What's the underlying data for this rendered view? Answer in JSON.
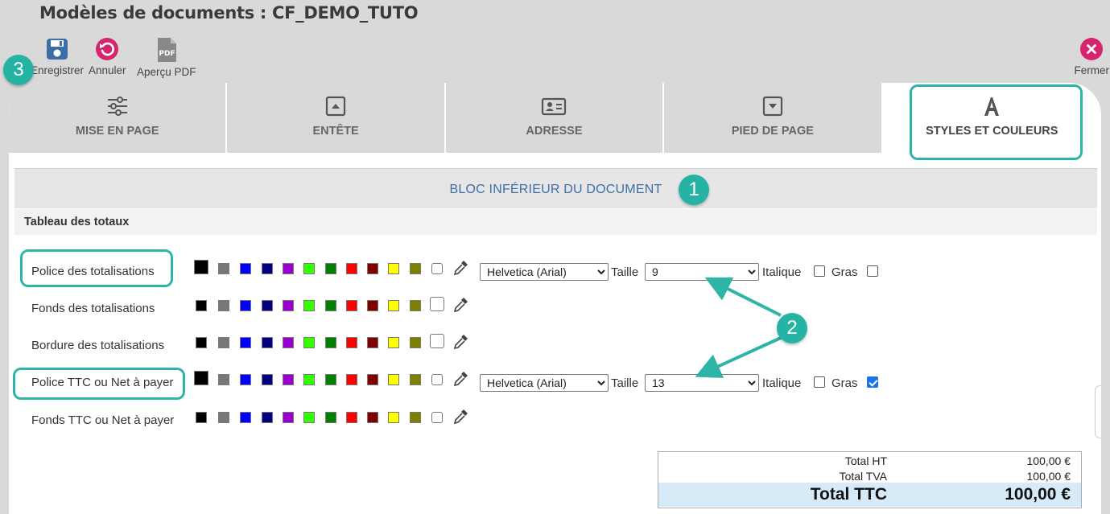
{
  "page": {
    "title": "Modèles de documents  : CF_DEMO_TUTO"
  },
  "toolbar": {
    "save_label": "Enregistrer",
    "cancel_label": "Annuler",
    "pdf_label": "Aperçu PDF",
    "pdf_icon_text": "PDF",
    "close_label": "Fermer"
  },
  "tabs": [
    {
      "label": "MISE EN PAGE",
      "icon": "sliders-icon"
    },
    {
      "label": "ENTÊTE",
      "icon": "header-icon"
    },
    {
      "label": "ADRESSE",
      "icon": "address-card-icon"
    },
    {
      "label": "PIED DE PAGE",
      "icon": "footer-icon"
    },
    {
      "label": "STYLES ET COULEURS",
      "icon": "font-icon",
      "active": true
    }
  ],
  "section": {
    "title": "BLOC INFÉRIEUR DU DOCUMENT",
    "subtitle": "Tableau des totaux"
  },
  "palette": [
    "#000000",
    "#777777",
    "#0000ff",
    "#000080",
    "#9900cc",
    "#33ff00",
    "#008000",
    "#ff0000",
    "#800000",
    "#ffff00",
    "#808000",
    "#ffffff"
  ],
  "rows": [
    {
      "label": "Police des totalisations",
      "font": "Helvetica (Arial)",
      "size_label": "Taille",
      "size": "9",
      "italic_label": "Italique",
      "italic": false,
      "bold_label": "Gras",
      "bold": false
    },
    {
      "label": "Fonds des totalisations"
    },
    {
      "label": "Bordure des totalisations"
    },
    {
      "label": "Police TTC ou Net à payer",
      "font": "Helvetica (Arial)",
      "size_label": "Taille",
      "size": "13",
      "italic_label": "Italique",
      "italic": false,
      "bold_label": "Gras",
      "bold": true
    },
    {
      "label": "Fonds TTC ou Net à payer"
    }
  ],
  "totals": [
    {
      "label": "Total HT",
      "value": "100,00 €"
    },
    {
      "label": "Total TVA",
      "value": "100,00 €"
    },
    {
      "label": "Total TTC",
      "value": "100,00 €"
    }
  ],
  "badges": [
    "1",
    "2",
    "3"
  ],
  "colors": {
    "accent": "#2fb5a7",
    "primary_icon": "#3a6ea5",
    "magenta": "#d6246e",
    "section_title": "#3d6fa6"
  }
}
